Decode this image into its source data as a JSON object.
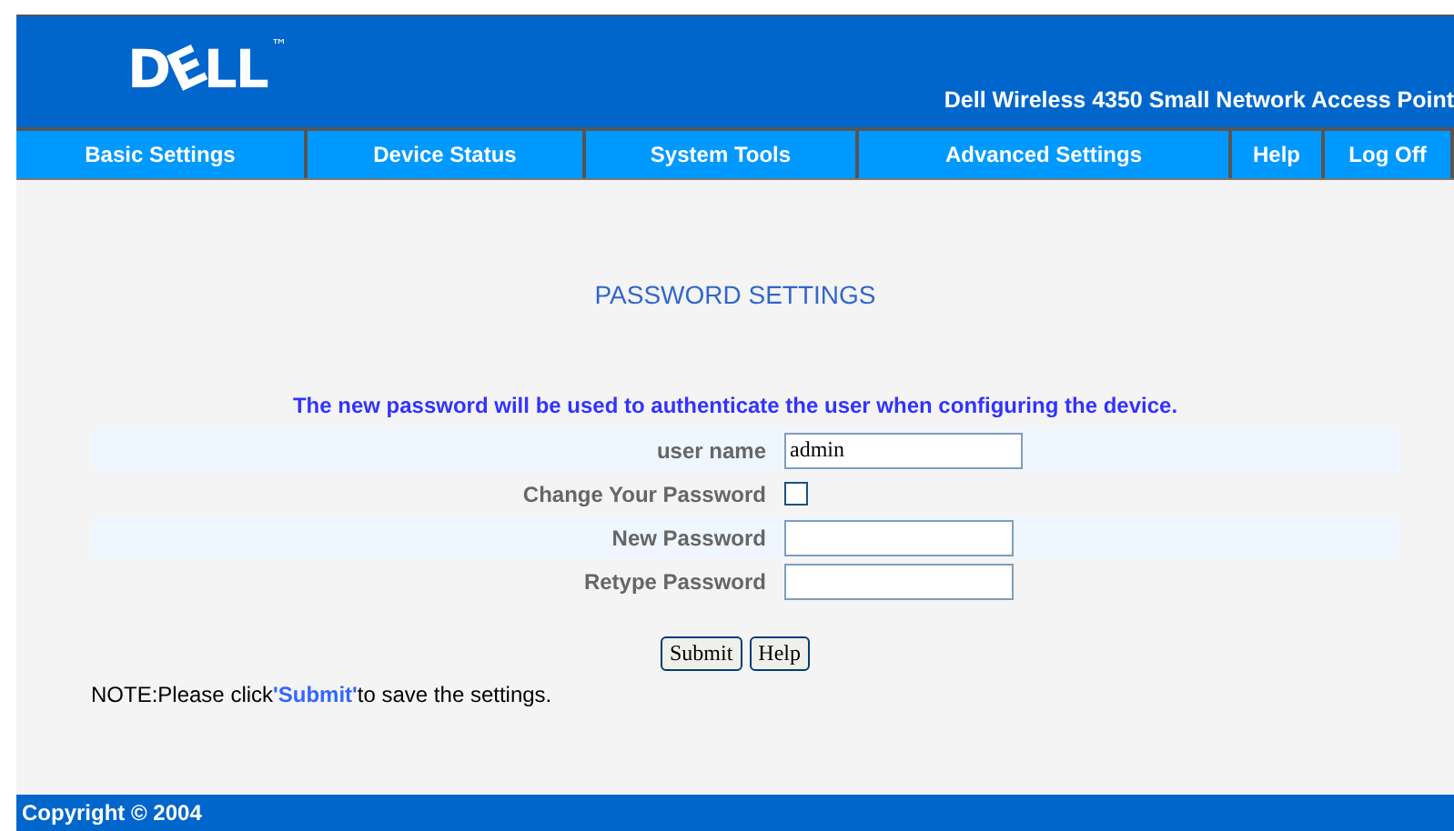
{
  "header": {
    "logo": "DELL",
    "logo_mark": "™",
    "product": "Dell Wireless 4350 Small Network Access Point"
  },
  "nav": [
    {
      "label": "Basic Settings"
    },
    {
      "label": "Device Status"
    },
    {
      "label": "System Tools"
    },
    {
      "label": "Advanced Settings"
    },
    {
      "label": "Help"
    },
    {
      "label": "Log Off"
    }
  ],
  "title": "PASSWORD SETTINGS",
  "intro": "The new password will be used to authenticate the user when configuring the device.",
  "fields": [
    {
      "kind": "text",
      "label": "user name",
      "value": "admin"
    },
    {
      "kind": "checkbox",
      "label": "Change Your Password",
      "checked": false
    },
    {
      "kind": "password",
      "label": "New Password"
    },
    {
      "kind": "password",
      "label": "Retype Password"
    }
  ],
  "buttons": [
    "Submit",
    "Help"
  ],
  "note": "NOTE:Please click**'Submit'**to save the settings.",
  "footer": "Copyright © 2004"
}
